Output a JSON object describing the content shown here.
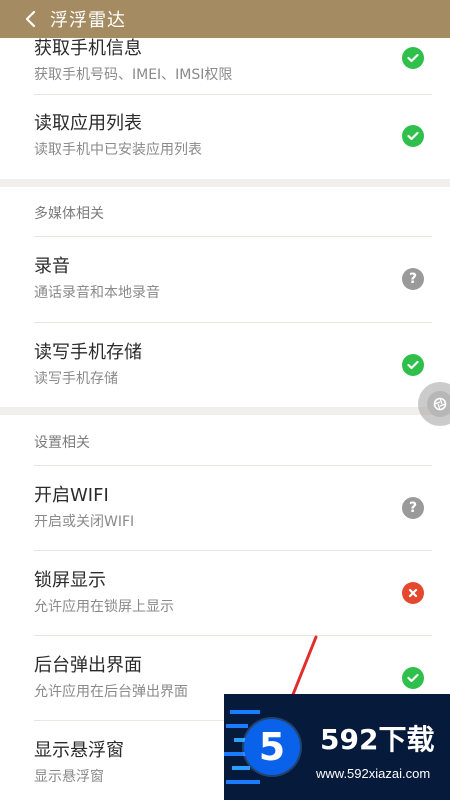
{
  "app": {
    "title": "浮浮雷达"
  },
  "top_row": {
    "title": "获取手机信息",
    "subtitle": "获取手机号码、IMEI、IMSI权限",
    "status_icon": "check-icon"
  },
  "items": [
    {
      "title": "读取应用列表",
      "subtitle": "读取手机中已安装应用列表",
      "status": "check"
    }
  ],
  "sections": [
    {
      "header": "多媒体相关",
      "items": [
        {
          "title": "录音",
          "subtitle": "通话录音和本地录音",
          "status": "ask"
        },
        {
          "title": "读写手机存储",
          "subtitle": "读写手机存储",
          "status": "check"
        }
      ]
    },
    {
      "header": "设置相关",
      "items": [
        {
          "title": "开启WIFI",
          "subtitle": "开启或关闭WIFI",
          "status": "ask"
        },
        {
          "title": "锁屏显示",
          "subtitle": "允许应用在锁屏上显示",
          "status": "deny"
        },
        {
          "title": "后台弹出界面",
          "subtitle": "允许应用在后台弹出界面",
          "status": "check"
        },
        {
          "title": "显示悬浮窗",
          "subtitle": "显示悬浮窗",
          "status": "none"
        }
      ]
    }
  ],
  "watermark": {
    "logo_digit": "5",
    "brand": "592下载",
    "url": "www.592xiazai.com"
  },
  "colors": {
    "topbar": "#a58b62",
    "check": "#2fbf4b",
    "ask": "#9a9a9a",
    "deny": "#e4492f"
  }
}
